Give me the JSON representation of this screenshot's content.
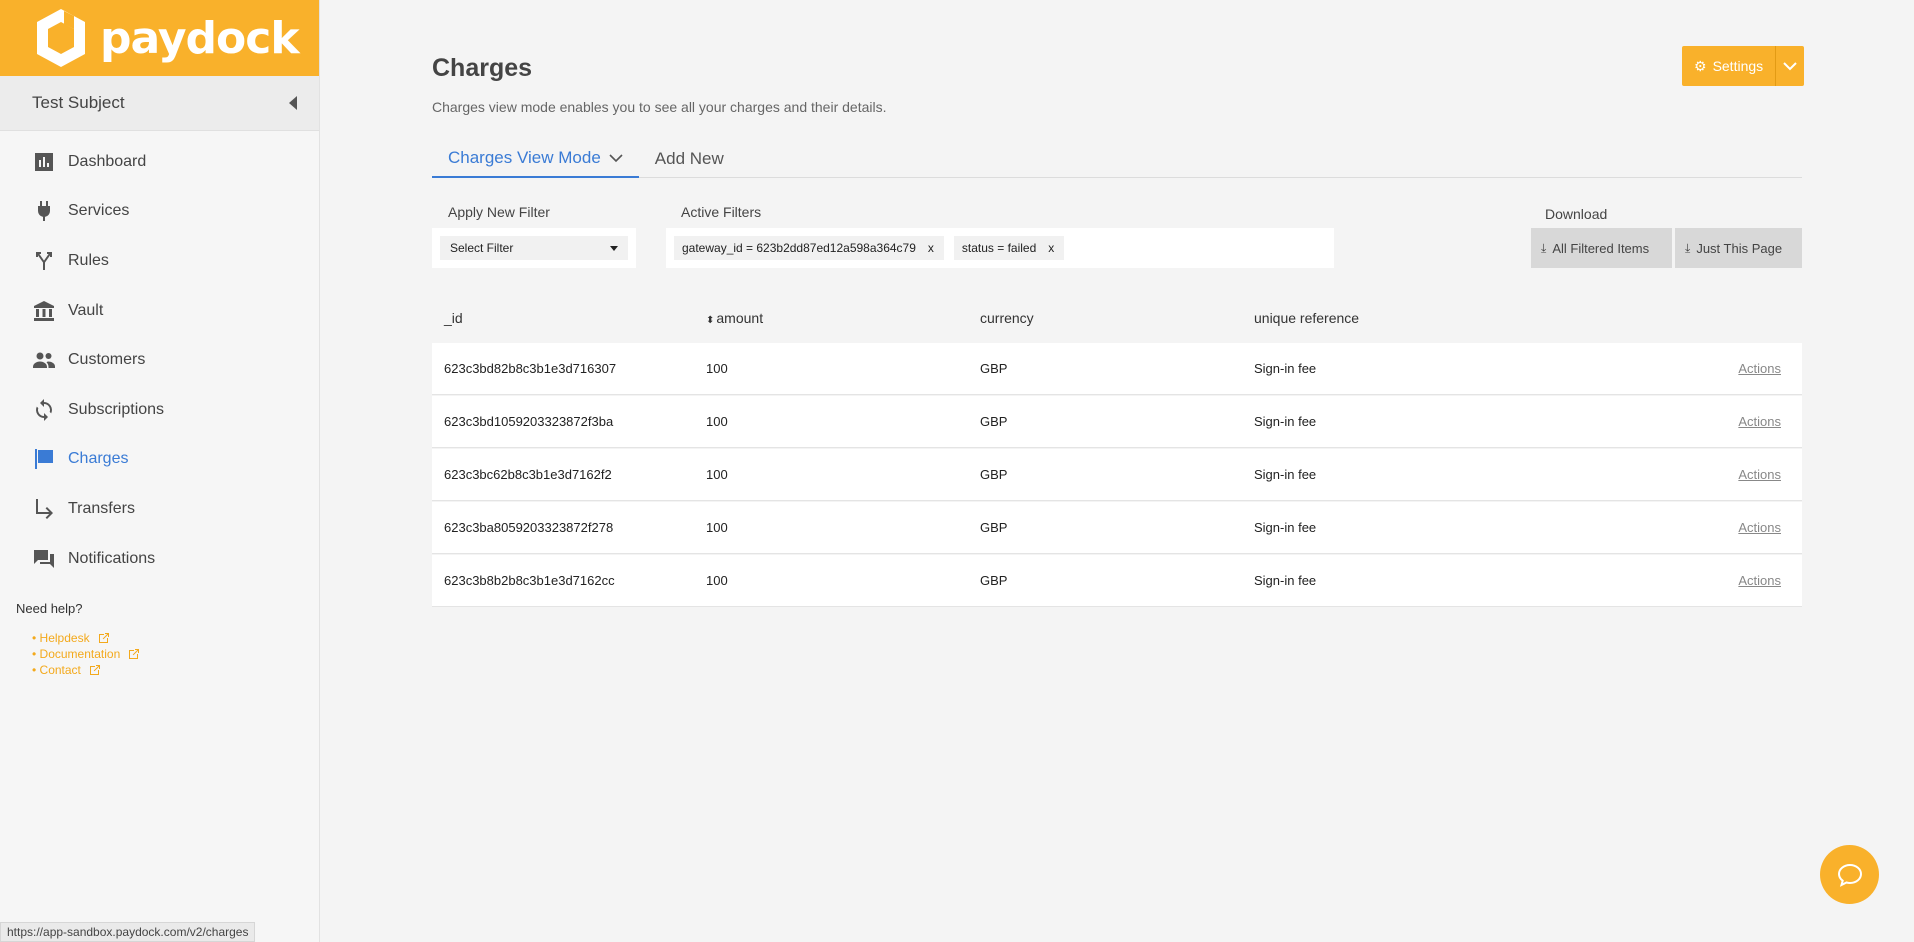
{
  "brand": {
    "name": "paydock",
    "color": "#f9b12b"
  },
  "account": {
    "name": "Test Subject"
  },
  "nav": [
    {
      "label": "Dashboard",
      "icon": "bar-chart-icon",
      "active": false
    },
    {
      "label": "Services",
      "icon": "plug-icon",
      "active": false
    },
    {
      "label": "Rules",
      "icon": "fork-icon",
      "active": false
    },
    {
      "label": "Vault",
      "icon": "bank-icon",
      "active": false
    },
    {
      "label": "Customers",
      "icon": "people-icon",
      "active": false
    },
    {
      "label": "Subscriptions",
      "icon": "refresh-icon",
      "active": false
    },
    {
      "label": "Charges",
      "icon": "flag-icon",
      "active": true
    },
    {
      "label": "Transfers",
      "icon": "turn-arrow-icon",
      "active": false
    },
    {
      "label": "Notifications",
      "icon": "chat-bubbles-icon",
      "active": false
    }
  ],
  "help": {
    "title": "Need help?",
    "links": [
      "• Helpdesk",
      "• Documentation",
      "• Contact"
    ]
  },
  "status_url": "https://app-sandbox.paydock.com/v2/charges",
  "page": {
    "title": "Charges",
    "description": "Charges view mode enables you to see all your charges and their details.",
    "settings_label": "Settings"
  },
  "tabs": [
    {
      "label": "Charges View Mode",
      "active": true
    },
    {
      "label": "Add New",
      "active": false
    }
  ],
  "filters": {
    "apply_label": "Apply New Filter",
    "select_value": "Select Filter",
    "active_label": "Active Filters",
    "chips": [
      "gateway_id = 623b2dd87ed12a598a364c79",
      "status = failed"
    ],
    "chip_remove": "x",
    "download_label": "Download",
    "download_all": "All Filtered Items",
    "download_page": "Just This Page"
  },
  "table": {
    "headers": [
      "_id",
      "amount",
      "currency",
      "unique reference"
    ],
    "action_label": "Actions",
    "rows": [
      {
        "id": "623c3bd82b8c3b1e3d716307",
        "amount": "100",
        "currency": "GBP",
        "reference": "Sign-in fee"
      },
      {
        "id": "623c3bd1059203323872f3ba",
        "amount": "100",
        "currency": "GBP",
        "reference": "Sign-in fee"
      },
      {
        "id": "623c3bc62b8c3b1e3d7162f2",
        "amount": "100",
        "currency": "GBP",
        "reference": "Sign-in fee"
      },
      {
        "id": "623c3ba8059203323872f278",
        "amount": "100",
        "currency": "GBP",
        "reference": "Sign-in fee"
      },
      {
        "id": "623c3b8b2b8c3b1e3d7162cc",
        "amount": "100",
        "currency": "GBP",
        "reference": "Sign-in fee"
      }
    ]
  }
}
